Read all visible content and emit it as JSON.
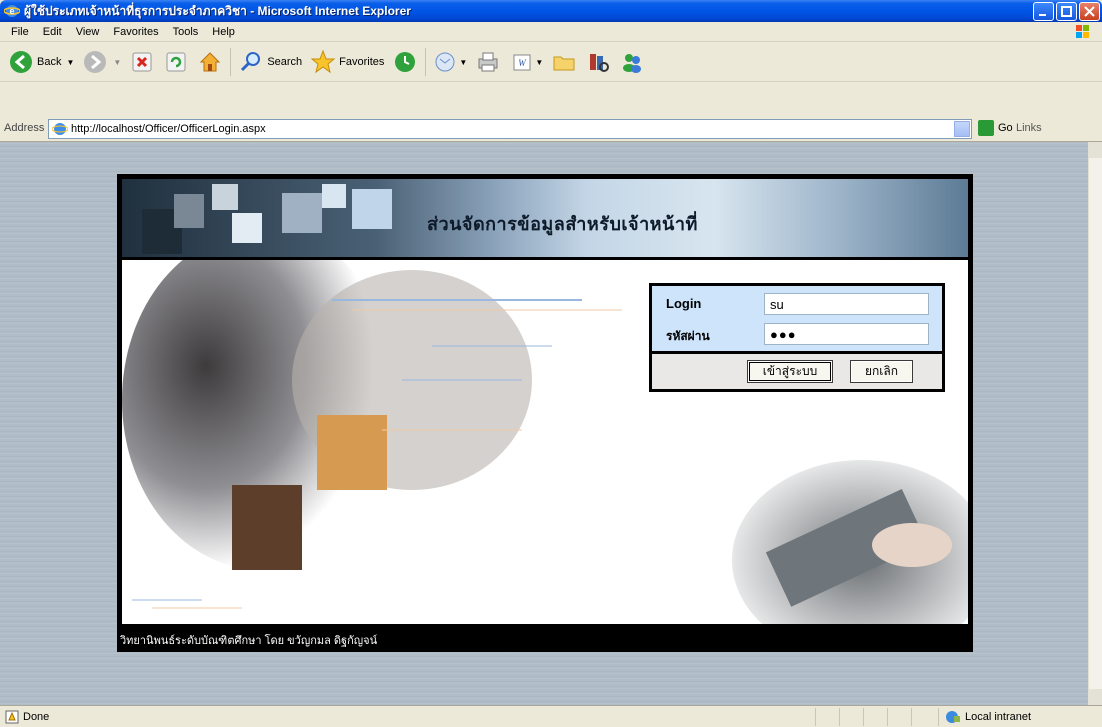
{
  "window": {
    "title": "ผู้ใช้ประเภทเจ้าหน้าที่ธุรการประจำภาควิชา - Microsoft Internet Explorer"
  },
  "menu": [
    "File",
    "Edit",
    "View",
    "Favorites",
    "Tools",
    "Help"
  ],
  "toolbar": {
    "back": "Back",
    "search": "Search",
    "favorites": "Favorites"
  },
  "address": {
    "label": "Address",
    "url": "http://localhost/Officer/OfficerLogin.aspx",
    "go": "Go",
    "links": "Links"
  },
  "page": {
    "banner_title": "ส่วนจัดการข้อมูลสำหรับเจ้าหน้าที่",
    "footer": "วิทยานิพนธ์ระดับบัณฑิตศึกษา โดย ขวัญกมล ดิฐกัญจน์",
    "login": {
      "username_label": "Login",
      "username_value": "su",
      "password_label": "รหัสผ่าน",
      "password_value": "●●●",
      "submit_label": "เข้าสู่ระบบ",
      "cancel_label": "ยกเลิก"
    }
  },
  "status": {
    "text": "Done",
    "zone": "Local intranet"
  },
  "colors": {
    "titlebar": "#0055e5",
    "login_panel": "#cde4fa",
    "page_bg": "#aebbc6"
  }
}
